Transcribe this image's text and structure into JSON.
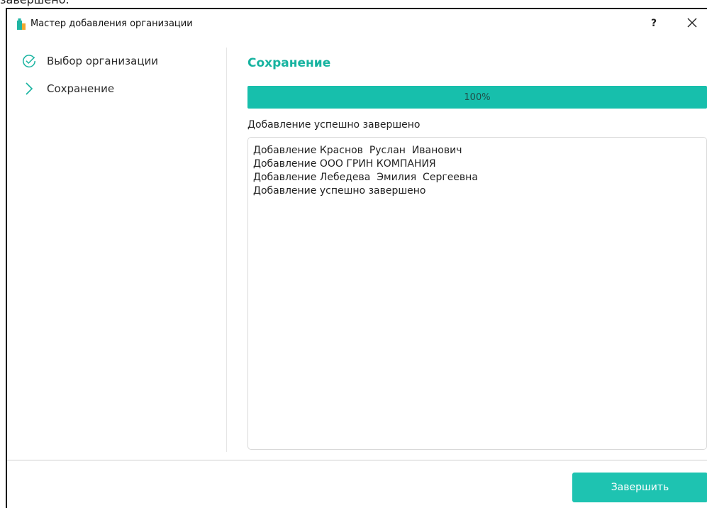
{
  "background_caption": "завершено.",
  "window": {
    "title": "Мастер добавления организации",
    "help_label": "?",
    "close_label": "✕"
  },
  "steps": [
    {
      "label": "Выбор организации",
      "state": "completed",
      "icon": "check-circle-icon"
    },
    {
      "label": "Сохранение",
      "state": "current",
      "icon": "chevron-right-icon"
    }
  ],
  "main": {
    "section_title": "Сохранение",
    "progress": {
      "value": 1.0,
      "label": "100%"
    },
    "status_text": "Добавление успешно завершено",
    "log_lines": [
      "Добавление Краснов  Руслан  Иванович",
      "Добавление ООО ГРИН КОМПАНИЯ",
      "Добавление Лебедева  Эмилия  Сергеевна",
      "Добавление успешно завершено"
    ]
  },
  "footer": {
    "finish_label": "Завершить"
  },
  "colors": {
    "accent": "#17b3a0",
    "progress_fill": "#17bfac",
    "button": "#1ec3b1",
    "app_icon": "#1fb5a3"
  }
}
